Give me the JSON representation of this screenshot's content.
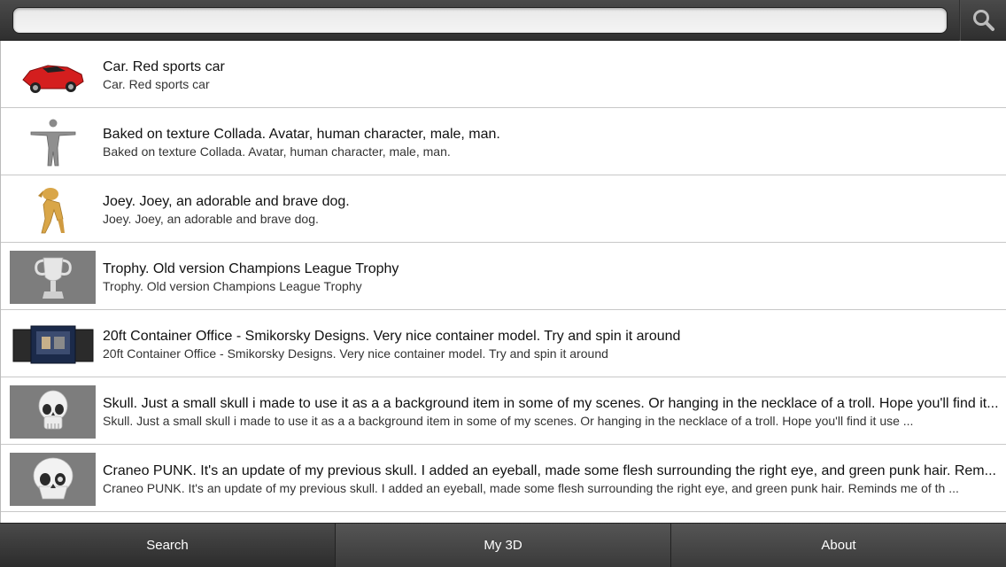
{
  "search": {
    "value": "",
    "placeholder": "",
    "button_icon": "search-icon"
  },
  "items": [
    {
      "title": "Car. Red sports car",
      "subtitle": "Car. Red sports car",
      "thumb": "red-sports-car"
    },
    {
      "title": "Baked on texture Collada. Avatar, human character, male, man.",
      "subtitle": "Baked on texture Collada. Avatar, human character, male, man.",
      "thumb": "human-avatar"
    },
    {
      "title": "Joey. Joey, an adorable and brave dog.",
      "subtitle": "Joey. Joey, an adorable and brave dog.",
      "thumb": "dog"
    },
    {
      "title": "Trophy. Old version Champions League Trophy",
      "subtitle": "Trophy. Old version Champions League Trophy",
      "thumb": "trophy"
    },
    {
      "title": "20ft Container Office - Smikorsky Designs. Very nice container model. Try and spin it around",
      "subtitle": "20ft Container Office - Smikorsky Designs. Very nice container model. Try and spin it around",
      "thumb": "container-office"
    },
    {
      "title": "Skull. Just a small skull i made to use it as a a background item in some of my scenes. Or hanging in the necklace of a troll. Hope you'll find it...",
      "subtitle": "Skull. Just a small skull i made to use it as a a background item in some of my scenes. Or hanging in the necklace of a troll. Hope you'll find it use ...",
      "thumb": "skull"
    },
    {
      "title": "Craneo PUNK. It's an update of my previous skull. I added an eyeball, made some flesh surrounding the right eye, and green punk hair. Rem...",
      "subtitle": "Craneo PUNK. It's an update of my previous skull. I added an eyeball, made some flesh surrounding the right eye, and green punk hair. Reminds me of th ...",
      "thumb": "punk-skull"
    }
  ],
  "tabs": [
    {
      "label": "Search",
      "active": true
    },
    {
      "label": "My 3D",
      "active": false
    },
    {
      "label": "About",
      "active": false
    }
  ],
  "colors": {
    "topbar": "#3a3a3a",
    "tabbar": "#3a3a3a",
    "thumb_gray": "#7d7d7d",
    "car_red": "#d41e1e",
    "dog_gold": "#d9a648"
  }
}
